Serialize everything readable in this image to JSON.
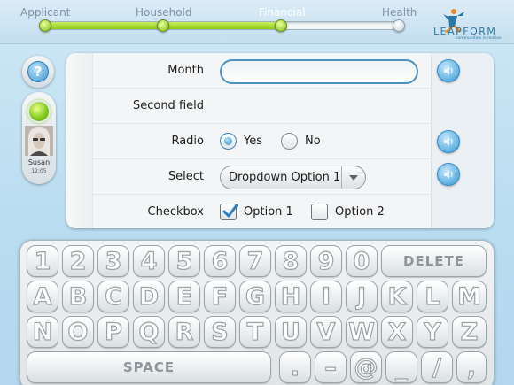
{
  "progress": {
    "steps": [
      {
        "label": "Applicant",
        "state": "done"
      },
      {
        "label": "Household",
        "state": "done"
      },
      {
        "label": "Financial",
        "state": "current"
      },
      {
        "label": "Health",
        "state": "pending"
      }
    ]
  },
  "logo": {
    "text": "LEAPFORM",
    "tagline": "communities in motion"
  },
  "user": {
    "name": "Susan",
    "time": "12:05",
    "status_color": "#7bc71a"
  },
  "help": {
    "label": "?"
  },
  "form": {
    "month": {
      "label": "Month",
      "value": "",
      "placeholder": ""
    },
    "second_field": {
      "label": "Second field"
    },
    "radio": {
      "label": "Radio",
      "options": [
        "Yes",
        "No"
      ],
      "selected": "Yes"
    },
    "select": {
      "label": "Select",
      "value": "Dropdown Option 1"
    },
    "checkbox": {
      "label": "Checkbox",
      "options": [
        "Option 1",
        "Option 2"
      ],
      "checked": [
        "Option 1"
      ]
    }
  },
  "keyboard": {
    "row1": [
      "1",
      "2",
      "3",
      "4",
      "5",
      "6",
      "7",
      "8",
      "9",
      "0"
    ],
    "delete_label": "DELETE",
    "row2": [
      "A",
      "B",
      "C",
      "D",
      "E",
      "F",
      "G",
      "H",
      "I",
      "J",
      "K",
      "L",
      "M"
    ],
    "row3": [
      "N",
      "O",
      "P",
      "Q",
      "R",
      "S",
      "T",
      "U",
      "V",
      "W",
      "X",
      "Y",
      "Z"
    ],
    "space_label": "SPACE",
    "row4": [
      ".",
      "–",
      "@",
      "_",
      "/",
      ","
    ]
  },
  "colors": {
    "accent": "#3c97d3",
    "progress": "#8ecb1f",
    "header_text": "#7d95a3"
  }
}
